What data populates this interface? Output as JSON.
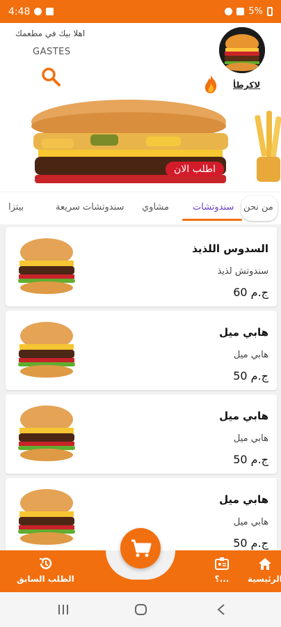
{
  "status_bar": {
    "time": "4:48",
    "battery": "5%"
  },
  "header": {
    "welcome_text": "اهلا بيك في مطعمك",
    "user_name": "GASTES",
    "offers_label": "لاكرطأ"
  },
  "banner": {
    "order_now_label": "اطلب الان"
  },
  "tabs": [
    {
      "label": "من نحن"
    },
    {
      "label": "سندوتشات"
    },
    {
      "label": "مشاوي"
    },
    {
      "label": "سندوتشات سريعة"
    },
    {
      "label": "بيتزا"
    }
  ],
  "products": [
    {
      "title": "السدوس اللذيذ",
      "description": "سندوتش لذيذ",
      "price": "60 ج.م"
    },
    {
      "title": "هابي ميل",
      "description": "هابي ميل",
      "price": "50 ج.م"
    },
    {
      "title": "هابي ميل",
      "description": "هابي ميل",
      "price": "50 ج.م"
    },
    {
      "title": "هابي ميل",
      "description": "هابي ميل",
      "price": "50 ج.م"
    }
  ],
  "bottom_nav": {
    "home_label": "الرئيسية",
    "middle_label": "؟...",
    "previous_order_label": "الطلب السابق"
  },
  "colors": {
    "accent": "#f26f0f",
    "active_tab": "#6a3fc4",
    "order_badge": "#d31c2a"
  }
}
